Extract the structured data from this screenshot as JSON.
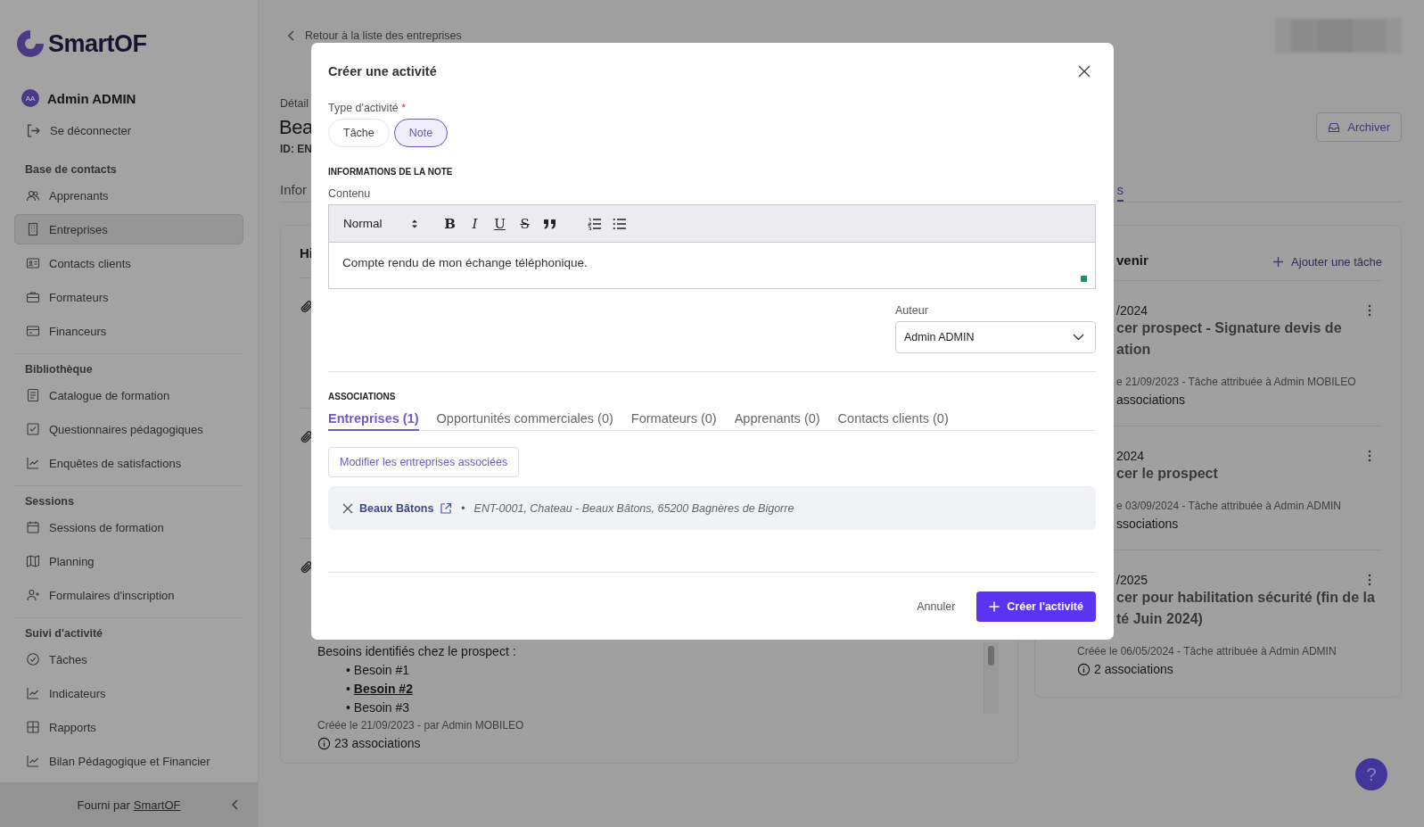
{
  "sidebar": {
    "logo": "SmartOF",
    "user": {
      "initials": "AA",
      "name": "Admin ADMIN"
    },
    "logout": "Se déconnecter",
    "sections": [
      {
        "title": "Base de contacts",
        "items": [
          {
            "label": "Apprenants",
            "selected": false
          },
          {
            "label": "Entreprises",
            "selected": true
          },
          {
            "label": "Contacts clients",
            "selected": false
          },
          {
            "label": "Formateurs",
            "selected": false
          },
          {
            "label": "Financeurs",
            "selected": false
          }
        ]
      },
      {
        "title": "Bibliothèque",
        "items": [
          {
            "label": "Catalogue de formation",
            "selected": false
          },
          {
            "label": "Questionnaires pédagogiques",
            "selected": false
          },
          {
            "label": "Enquêtes de satisfactions",
            "selected": false
          }
        ]
      },
      {
        "title": "Sessions",
        "items": [
          {
            "label": "Sessions de formation",
            "selected": false
          },
          {
            "label": "Planning",
            "selected": false
          },
          {
            "label": "Formulaires d'inscription",
            "selected": false
          }
        ]
      },
      {
        "title": "Suivi d'activité",
        "items": [
          {
            "label": "Tâches",
            "selected": false
          },
          {
            "label": "Indicateurs",
            "selected": false
          },
          {
            "label": "Rapports",
            "selected": false
          },
          {
            "label": "Bilan Pédagogique et Financier",
            "selected": false
          }
        ]
      }
    ],
    "footer": {
      "text": "Fourni par",
      "link": "SmartOF"
    }
  },
  "page": {
    "back_link": "Retour à la liste des entreprises",
    "eyebrow": "Détail",
    "title": "Bea",
    "id": "ID: EN",
    "archive_button": "Archiver",
    "tabs": [
      {
        "label": "Infor",
        "selected": false
      },
      {
        "label": "s",
        "selected": true
      }
    ],
    "history": {
      "title": "Hi",
      "note": {
        "intro": "Besoins identifiés chez le prospect :",
        "bullets": [
          {
            "marker": "•",
            "text": "Besoin #1",
            "emphasis": false
          },
          {
            "marker": "•",
            "text": "Besoin #2",
            "emphasis": true
          },
          {
            "marker": "•",
            "text": "Besoin #3",
            "emphasis": false
          }
        ]
      },
      "meta": "Créée le 21/09/2023 - par Admin MOBILEO",
      "associations": "23 associations"
    },
    "tasks": {
      "title": "venir",
      "add_button": "Ajouter une tâche",
      "items": [
        {
          "date": "/2024",
          "title_lines": [
            "cer prospect - Signature devis de",
            "ation"
          ],
          "meta": "e 21/09/2023 - Tâche attribuée à Admin MOBILEO",
          "associations": "associations",
          "partly_covered": true
        },
        {
          "date": "2024",
          "title_lines": [
            "cer le prospect"
          ],
          "meta": "e 03/09/2024 - Tâche attribuée à Admin ADMIN",
          "associations": "ssociations",
          "partly_covered": true
        },
        {
          "date": "/2025",
          "title_lines": [
            "cer pour habilitation sécurité (fin de la",
            "té Juin 2024)"
          ],
          "meta": "Créée le 06/05/2024 - Tâche attribuée à Admin ADMIN",
          "associations": "2 associations",
          "partly_covered": false
        }
      ]
    },
    "help_button": "?"
  },
  "modal": {
    "title": "Créer une activité",
    "type_label": "Type d'activité",
    "required_mark": "*",
    "types": [
      {
        "label": "Tâche",
        "selected": false
      },
      {
        "label": "Note",
        "selected": true
      }
    ],
    "section_title": "INFORMATIONS DE LA NOTE",
    "content_label": "Contenu",
    "editor": {
      "format": "Normal",
      "buttons": [
        {
          "kind": "bold",
          "label": "B"
        },
        {
          "kind": "italic",
          "label": "I"
        },
        {
          "kind": "underline",
          "label": "U"
        },
        {
          "kind": "strike",
          "label": "S"
        }
      ],
      "value": "Compte rendu de mon échange téléphonique."
    },
    "author_label": "Auteur",
    "author": "Admin ADMIN",
    "associations_title": "ASSOCIATIONS",
    "tabs": [
      {
        "label": "Entreprises (1)",
        "selected": true
      },
      {
        "label": "Opportunités commerciales (0)",
        "selected": false
      },
      {
        "label": "Formateurs (0)",
        "selected": false
      },
      {
        "label": "Apprenants (0)",
        "selected": false
      },
      {
        "label": "Contacts clients (0)",
        "selected": false
      }
    ],
    "modify_button": "Modifier les entreprises associées",
    "association": {
      "name": "Beaux Bâtons",
      "separator": "•",
      "detail": "ENT-0001, Chateau - Beaux Bâtons, 65200 Bagnères de Bigorre"
    },
    "cancel": "Annuler",
    "submit": "Créer l'activité"
  }
}
